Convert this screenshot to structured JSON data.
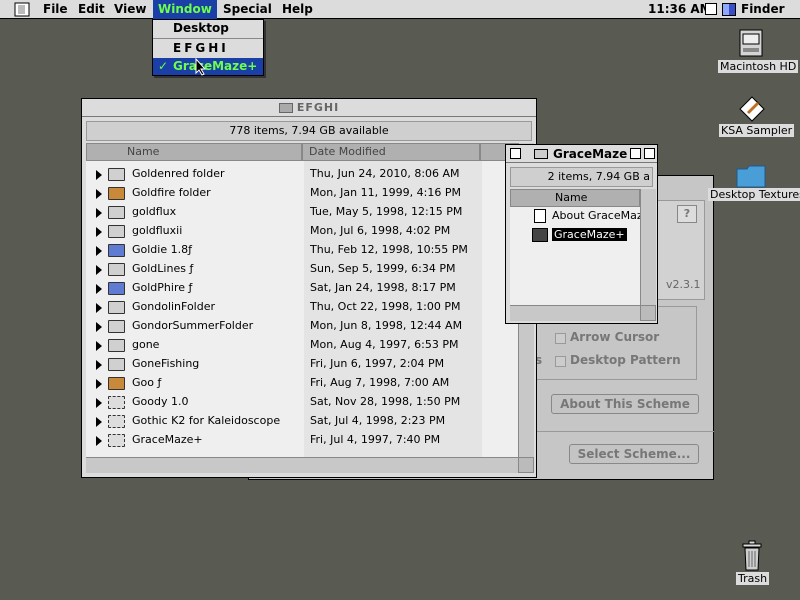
{
  "menubar": {
    "menus": [
      "File",
      "Edit",
      "View",
      "Window",
      "Special",
      "Help"
    ],
    "active_menu": "Window",
    "clock": "11:36 AM",
    "app_name": "Finder"
  },
  "window_menu": {
    "items": [
      "Desktop",
      "EFGHI",
      "GraceMaze+"
    ],
    "checked": "✓"
  },
  "efghi_window": {
    "title": "EFGHI",
    "status": "778 items, 7.94 GB available",
    "col_name": "Name",
    "col_date": "Date Modified",
    "rows": [
      {
        "name": "Goldenred folder",
        "date": "Thu, Jun 24, 2010, 8:06 AM",
        "kind": "folder"
      },
      {
        "name": "Goldfire folder",
        "date": "Mon, Jan 11, 1999, 4:16 PM",
        "kind": "gold"
      },
      {
        "name": "goldflux",
        "date": "Tue, May 5, 1998, 12:15 PM",
        "kind": "folder"
      },
      {
        "name": "goldfluxii",
        "date": "Mon, Jul 6, 1998, 4:02 PM",
        "kind": "folder"
      },
      {
        "name": "Goldie 1.8ƒ",
        "date": "Thu, Feb 12, 1998, 10:55 PM",
        "kind": "app"
      },
      {
        "name": "GoldLines ƒ",
        "date": "Sun, Sep 5, 1999, 6:34 PM",
        "kind": "folder"
      },
      {
        "name": "GoldPhire ƒ",
        "date": "Sat, Jan 24, 1998, 8:17 PM",
        "kind": "app"
      },
      {
        "name": "GondolinFolder",
        "date": "Thu, Oct 22, 1998, 1:00 PM",
        "kind": "folder"
      },
      {
        "name": "GondorSummerFolder",
        "date": "Mon, Jun 8, 1998, 12:44 AM",
        "kind": "folder"
      },
      {
        "name": "gone",
        "date": "Mon, Aug 4, 1997, 6:53 PM",
        "kind": "folder"
      },
      {
        "name": "GoneFishing",
        "date": "Fri, Jun 6, 1997, 2:04 PM",
        "kind": "folder"
      },
      {
        "name": "Goo ƒ",
        "date": "Fri, Aug 7, 1998, 7:00 AM",
        "kind": "gold"
      },
      {
        "name": "Goody 1.0",
        "date": "Sat, Nov 28, 1998, 1:50 PM",
        "kind": "prog"
      },
      {
        "name": "Gothic K2 for Kaleidoscope",
        "date": "Sat, Jul 4, 1998, 2:23 PM",
        "kind": "prog"
      },
      {
        "name": "GraceMaze+",
        "date": "Fri, Jul 4, 1997, 7:40 PM",
        "kind": "prog"
      }
    ]
  },
  "gracemaze_window": {
    "title": "GraceMaze",
    "status": "2 items, 7.94 GB a",
    "col_name": "Name",
    "items": [
      "About GraceMaze",
      "GraceMaze+"
    ]
  },
  "scheme_panel": {
    "version": "v2.3.1",
    "help": "?",
    "arrow_cursor": "Arrow Cursor",
    "desktop_pattern": "Desktop Pattern",
    "partial_s": "s",
    "about_button": "About This Scheme",
    "select_button": "Select Scheme..."
  },
  "desktop_icons": [
    "Macintosh HD",
    "KSA Sampler",
    "Desktop Textures",
    "Trash"
  ],
  "colors": {
    "highlight": "#1a3fa6",
    "highlight_text": "#6cff4a",
    "desktop": "#595a51"
  }
}
